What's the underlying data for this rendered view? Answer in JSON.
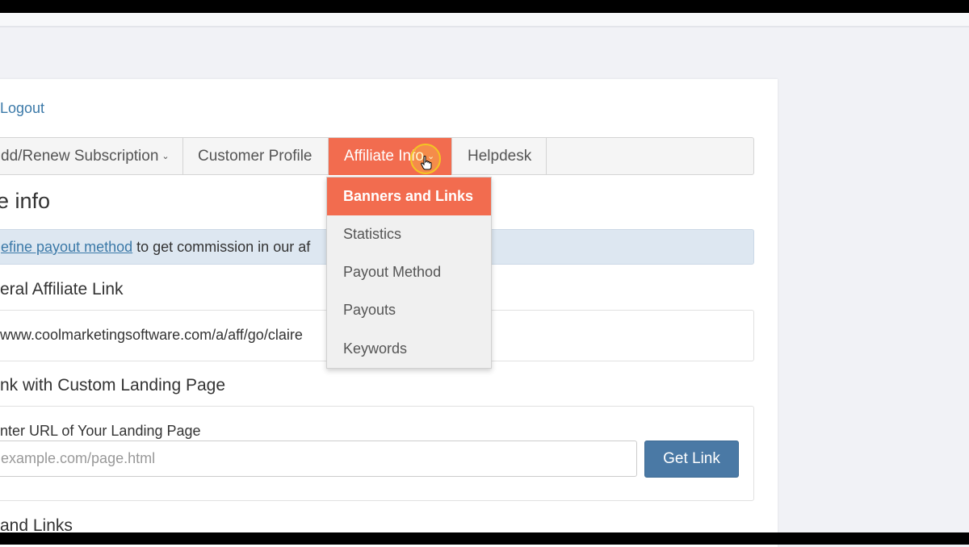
{
  "header": {
    "logout_label": "Logout"
  },
  "nav": {
    "items": [
      {
        "label": "dd/Renew Subscription",
        "caret": "⌄"
      },
      {
        "label": "Customer Profile"
      },
      {
        "label": "Affiliate Info",
        "caret": "⌄"
      },
      {
        "label": "Helpdesk"
      }
    ],
    "active_color": "#f26c4f"
  },
  "dropdown": {
    "items": [
      {
        "label": "Banners and Links"
      },
      {
        "label": "Statistics"
      },
      {
        "label": "Payout Method"
      },
      {
        "label": "Payouts"
      },
      {
        "label": "Keywords"
      }
    ]
  },
  "page": {
    "title": "e info",
    "alert": {
      "link_text": "efine payout method",
      "text": " to get commission in our af"
    },
    "general_link": {
      "heading": "eral Affiliate Link",
      "url": "www.coolmarketingsoftware.com/a/aff/go/claire"
    },
    "custom_link": {
      "heading": "nk with Custom Landing Page",
      "field_label": "nter URL of Your Landing Page",
      "placeholder": "example.com/page.html",
      "button_label": "Get Link"
    },
    "banners_heading": "and Links"
  }
}
